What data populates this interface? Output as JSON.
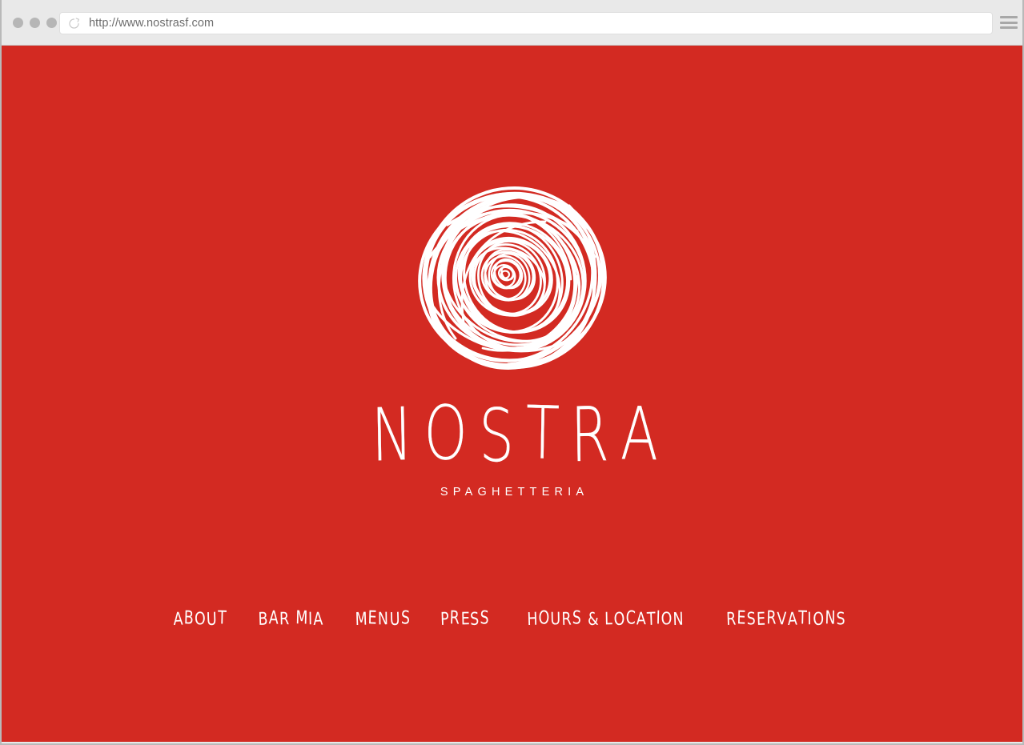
{
  "browser": {
    "url": "http://www.nostrasf.com",
    "url_placeholder": "Search or enter website name",
    "reload_icon": "reload-icon",
    "menu_icon": "hamburger-menu-icon",
    "traffic_lights": [
      "close-dot",
      "minimize-dot",
      "maximize-dot"
    ]
  },
  "site": {
    "background_color": "#D32A22",
    "text_color": "#FFFFFF",
    "logo": {
      "icon": "scribbled-rose-logo",
      "alt": "Nostra scribbled rose logo"
    },
    "brand": {
      "title": "NOSTRA",
      "subtitle": "SPAGHETTERIA"
    },
    "nav": [
      {
        "label": "About"
      },
      {
        "label": "Bar Mia"
      },
      {
        "label": "Menus"
      },
      {
        "label": "Press"
      },
      {
        "label": "Hours & Location"
      },
      {
        "label": "Reservations"
      }
    ]
  }
}
